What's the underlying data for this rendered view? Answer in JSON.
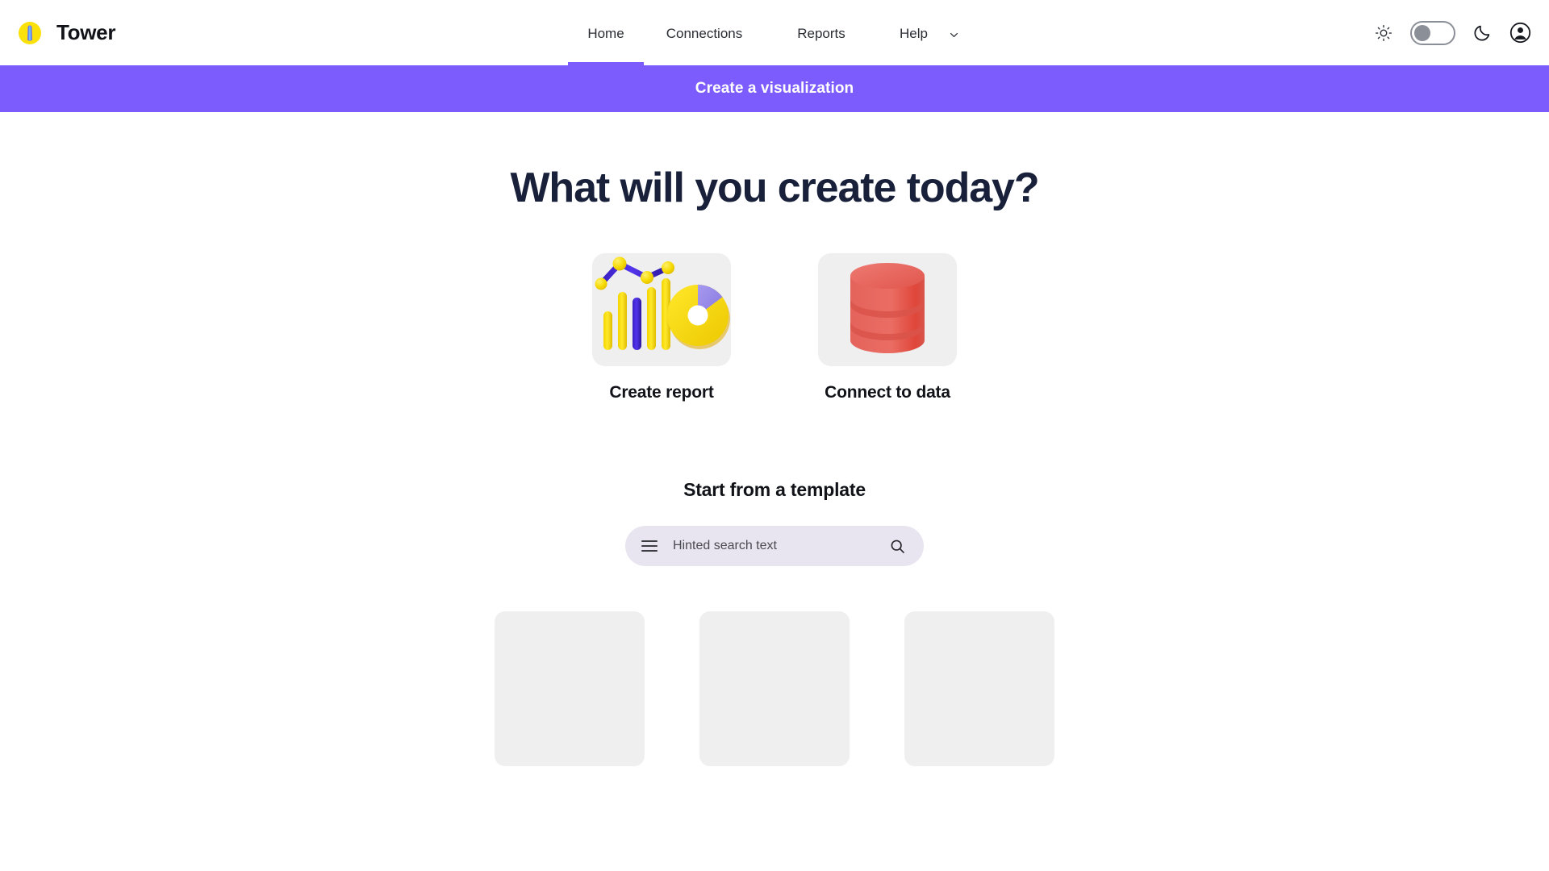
{
  "app": {
    "brand_name": "Tower",
    "logo_icon": "tower-logo-icon"
  },
  "nav": {
    "items": [
      {
        "label": "Home",
        "active": true
      },
      {
        "label": "Connections",
        "active": false
      },
      {
        "label": "Reports",
        "active": false
      },
      {
        "label": "Help",
        "active": false,
        "has_dropdown": true
      }
    ],
    "right": {
      "sun_icon": "sun-icon",
      "moon_icon": "moon-icon",
      "account_icon": "account-circle-icon",
      "theme_toggle_state": "off"
    }
  },
  "banner": {
    "text": "Create a visualization",
    "color": "#7c5cfc"
  },
  "hero": {
    "title": "What will you create today?"
  },
  "create_options": [
    {
      "label": "Create report",
      "icon": "chart-report-icon"
    },
    {
      "label": "Connect to data",
      "icon": "database-icon"
    }
  ],
  "templates": {
    "title": "Start from a template",
    "search": {
      "placeholder": "Hinted search text",
      "value": "",
      "menu_icon": "hamburger-menu-icon",
      "search_icon": "search-icon"
    },
    "cards": [
      {
        "id": "template-card-1"
      },
      {
        "id": "template-card-2"
      },
      {
        "id": "template-card-3"
      }
    ]
  },
  "colors": {
    "accent": "#7c5cfc",
    "heading": "#18203a",
    "placeholder_card": "#efefef",
    "search_bg": "#e9e5f0",
    "chart_yellow": "#f5e11a",
    "chart_blue": "#3b24c4",
    "chart_purple": "#9b8ee8",
    "db_red": "#e8625a"
  }
}
